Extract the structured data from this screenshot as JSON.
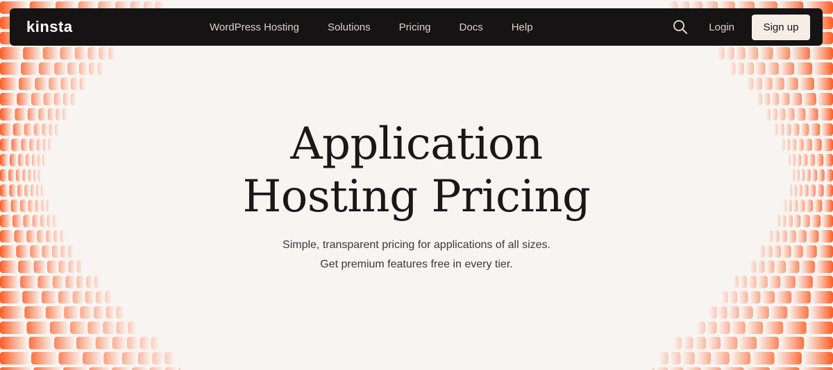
{
  "nav": {
    "logo_text": "kinsta",
    "links": [
      {
        "label": "WordPress Hosting"
      },
      {
        "label": "Solutions"
      },
      {
        "label": "Pricing"
      },
      {
        "label": "Docs"
      },
      {
        "label": "Help"
      }
    ],
    "search_icon": "search-icon",
    "login_label": "Login",
    "signup_label": "Sign up"
  },
  "hero": {
    "title_line1": "Application",
    "title_line2": "Hosting Pricing",
    "subtitle_line1": "Simple, transparent pricing for applications of all sizes.",
    "subtitle_line2": "Get premium features free in every tier."
  },
  "colors": {
    "background": "#f8f4f1",
    "navbar": "#161314",
    "accent": "#ff5b22",
    "signup_bg": "#f6ede7"
  }
}
